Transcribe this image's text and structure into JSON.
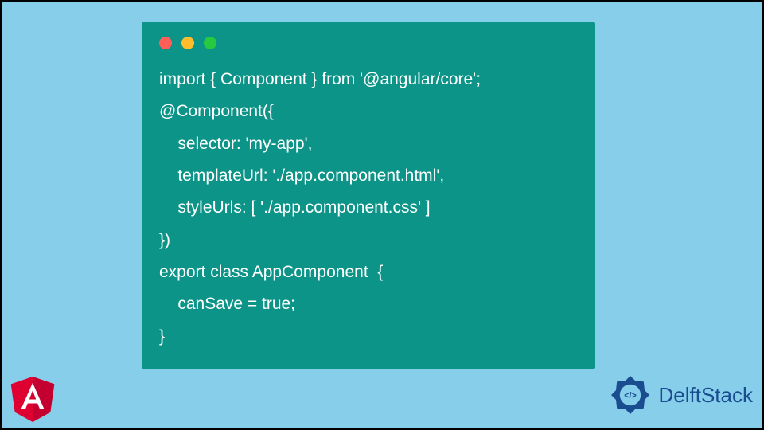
{
  "code": {
    "line1": "import { Component } from '@angular/core';",
    "line2": "@Component({",
    "line3": "    selector: 'my-app',",
    "line4": "    templateUrl: './app.component.html',",
    "line5": "    styleUrls: [ './app.component.css' ]",
    "line6": "})",
    "line7": "export class AppComponent  {",
    "line8": "    canSave = true;",
    "line9": "}"
  },
  "branding": {
    "delft_text": "DelftStack"
  }
}
